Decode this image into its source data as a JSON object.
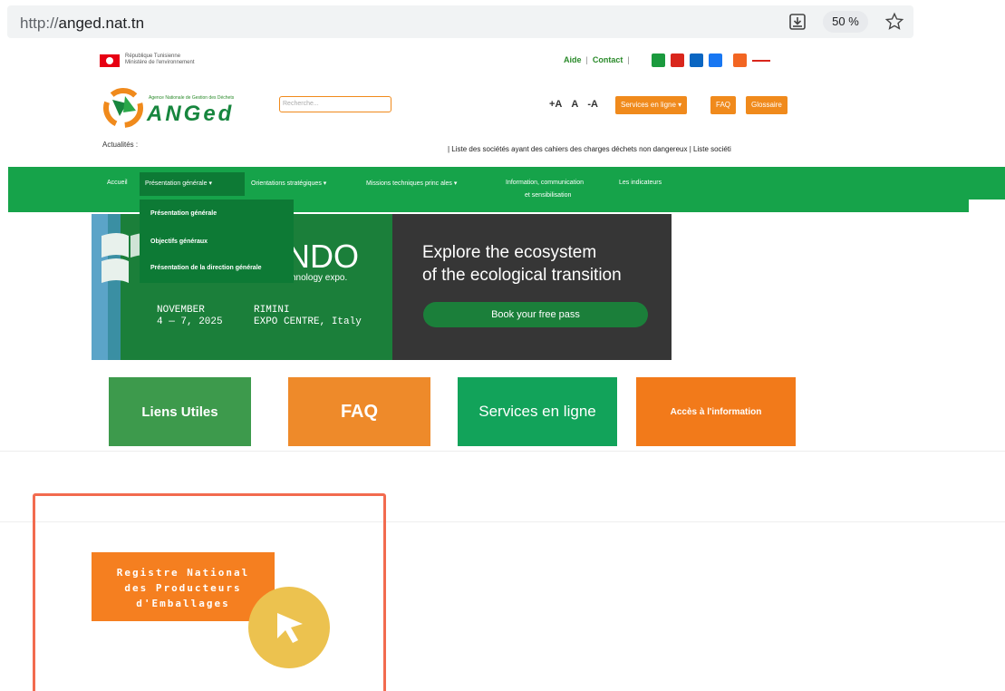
{
  "browser": {
    "url_scheme": "http://",
    "url_host": "anged.nat.tn",
    "zoom": "50 %"
  },
  "site": {
    "republic_line1": "République Tunisienne",
    "republic_line2": "Ministère de l'environnement",
    "toplinks": [
      "Aide",
      "Contact"
    ],
    "social_icons": [
      "print-icon",
      "pdf-icon",
      "linkedin-icon",
      "facebook-icon",
      "rss-icon"
    ],
    "logo_small": "Agence Nationale de Gestion des Déchets",
    "logo_text": "ANGed",
    "search_placeholder": "Recherche...",
    "font_size_controls": [
      "+A",
      "A",
      "-A"
    ],
    "header_buttons": {
      "services": "Services en ligne ▾",
      "faq": "FAQ",
      "glossary": "Glossaire"
    },
    "news_label": "Actualités :",
    "news_ticker": "| Liste des sociétés ayant des cahiers des charges déchets non dangereux  |  Liste sociéti"
  },
  "nav": {
    "items": [
      "Accueil",
      "Présentation générale ▾",
      "Orientations stratégiques ▾",
      "Missions techniques princ  ales ▾",
      "Information, communication",
      "Les indicateurs"
    ],
    "item_line2": "et sensibilisation",
    "dropdown": [
      "Présentation générale",
      "Objectifs généraux",
      "Présentation de la direction générale"
    ]
  },
  "banner": {
    "logo_fragment": "NDO",
    "tagline": "chnology expo.",
    "date": "NOVEMBER\n4 — 7, 2025",
    "place": "RIMINI\nEXPO CENTRE, Italy",
    "headline": "Explore the ecosystem\nof the ecological transition",
    "cta": "Book your free pass"
  },
  "tiles": {
    "liens_utiles": "Liens Utiles",
    "faq": "FAQ",
    "services": "Services en ligne",
    "acces": "Accès à l'information"
  },
  "registry_button": "Registre National\ndes Producteurs\nd'Emballages",
  "colors": {
    "green": "#16a34a",
    "orange": "#f08a1c",
    "highlight": "#f26b4f",
    "cursor": "#ecc24f"
  }
}
